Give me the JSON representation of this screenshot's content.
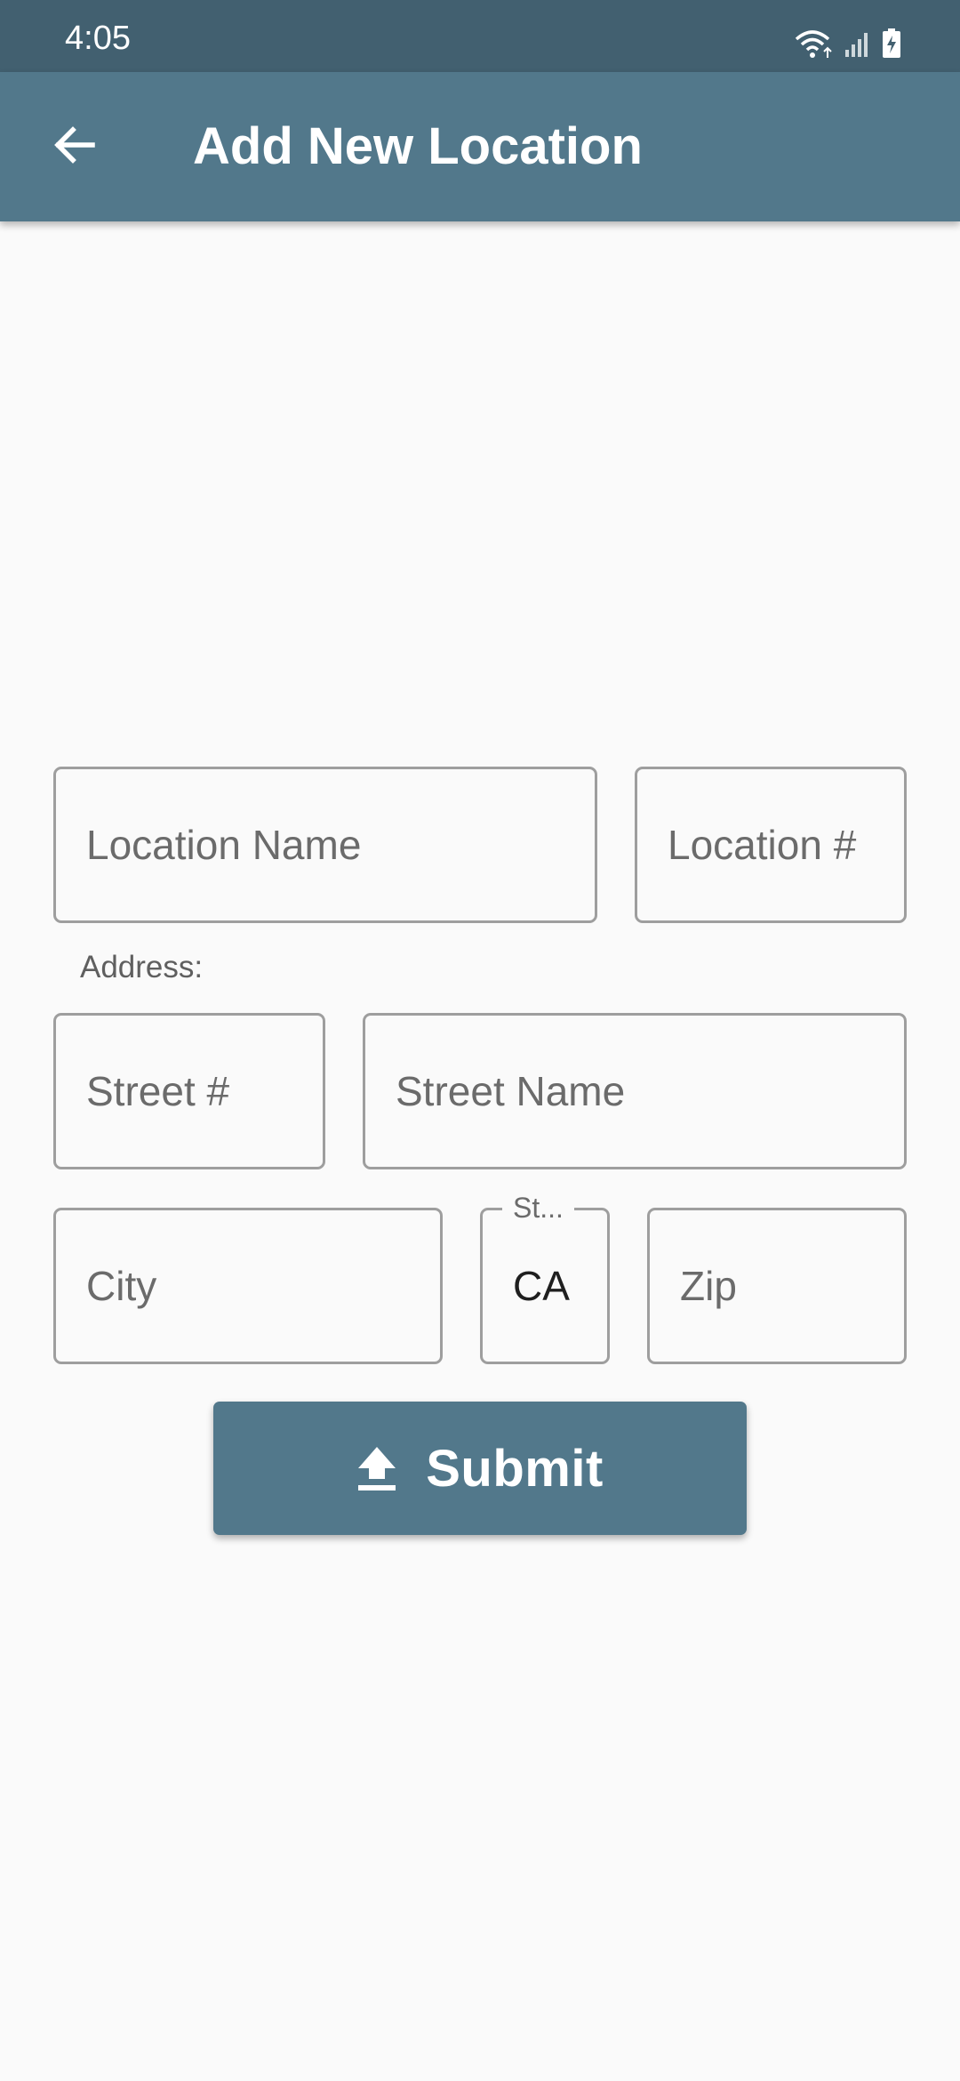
{
  "status_bar": {
    "time": "4:05",
    "icons": [
      "wifi-icon",
      "signal-icon",
      "battery-charging-icon"
    ]
  },
  "app_bar": {
    "back_icon": "arrow-left-icon",
    "title": "Add New Location"
  },
  "form": {
    "location_name": {
      "placeholder": "Location Name",
      "value": ""
    },
    "location_number": {
      "placeholder": "Location #",
      "value": ""
    },
    "address_label": "Address:",
    "street_number": {
      "placeholder": "Street #",
      "value": ""
    },
    "street_name": {
      "placeholder": "Street Name",
      "value": ""
    },
    "city": {
      "placeholder": "City",
      "value": ""
    },
    "state": {
      "label": "St...",
      "value": "CA"
    },
    "zip": {
      "placeholder": "Zip",
      "value": ""
    }
  },
  "submit": {
    "icon": "upload-icon",
    "label": "Submit"
  },
  "colors": {
    "status_bar": "#426070",
    "primary": "#52788b",
    "background": "#fafafa",
    "field_border": "#9e9e9e"
  }
}
